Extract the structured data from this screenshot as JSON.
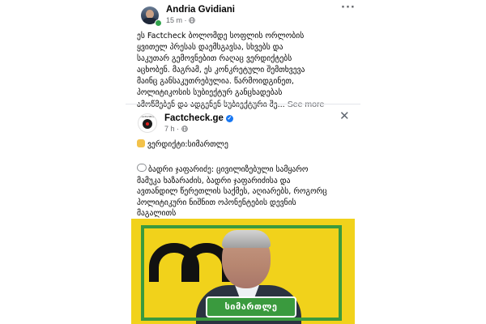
{
  "post": {
    "author": "Andria Gvidiani",
    "time": "15 m",
    "privacy_icon": "globe-icon",
    "menu_icon": "more-dots-icon",
    "text_lines": [
      "ეს Factcheck ბოლომდე სოფლის ორლობის",
      "ყვითელ პრესას დაემსგავსა, სხვებს და",
      "საკუთარ გემოვნებით რაღაც ვერდიქტებს",
      "აცხობენ. მაგრამ, ეს კონკრეტული შემთხვევა",
      "მაინც განსაკუთრებულია. წარმოიდგინეთ,",
      "პოლიტიკოსის სუბიექტურ განცხადებას",
      "ამოწმებენ და ადგენენ სუბიექტური შე..."
    ],
    "see_more": "See more"
  },
  "shared": {
    "page_name": "Factcheck.ge",
    "avatar_text": "FACTCHECK",
    "time": "7 h",
    "privacy_icon": "globe-icon",
    "verified_icon": "verified-badge-icon",
    "close_icon": "close-icon",
    "verdict": "ვერდიქტი:სიმართლე",
    "quote_lines": [
      "ბადრი ჯაფარიძე: ცივილიზებული სამყარო",
      "მამუკა ხაზარაძის, ბადრი ჯაფარიძისა და",
      "ავთანდილ წერეთლის საქმეს, აღიარებს, როგორც",
      "პოლიტიკური ნიშნით ოპონენტების დევნის",
      "მაგალითს"
    ],
    "image_stamp": "სიმართლე"
  },
  "colors": {
    "frame_green": "#3a9a3e",
    "background_yellow": "#f1d21b",
    "verified_blue": "#1877f2",
    "online_green": "#31a24c"
  }
}
